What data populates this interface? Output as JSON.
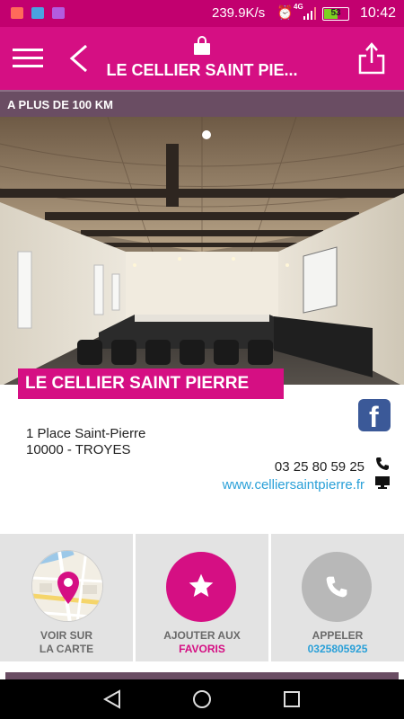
{
  "status_bar": {
    "network_speed": "239.9K/s",
    "network_type": "4G",
    "battery_level": "53",
    "battery_fraction": 0.53,
    "time": "10:42",
    "icons": [
      "notification-heart-icon",
      "notification-cloud-icon",
      "notification-gallery-icon",
      "alarm-icon",
      "signal-icon",
      "battery-icon"
    ]
  },
  "app_bar": {
    "title": "LE CELLIER SAINT PIE...",
    "icons": [
      "menu-icon",
      "back-icon",
      "shopping-bag-icon",
      "share-icon"
    ]
  },
  "distance_label": "A PLUS DE 100 KM",
  "venue": {
    "name": "LE CELLIER SAINT PIERRE",
    "address_line1": "1 Place Saint-Pierre",
    "address_line2": "10000 - TROYES",
    "phone": "03 25 80 59 25",
    "website": "www.celliersaintpierre.fr"
  },
  "actions": {
    "map": {
      "line1": "VOIR SUR",
      "line2": "LA CARTE"
    },
    "favorite": {
      "line1": "AJOUTER AUX",
      "line2": "FAVORIS"
    },
    "call": {
      "line1": "APPELER",
      "line2": "0325805925"
    }
  },
  "colors": {
    "brand_pink": "#d50f83",
    "status_bar": "#c2006f",
    "accent_plum": "#6a4d63",
    "link_blue": "#2aa0d8",
    "facebook_blue": "#3b5998"
  }
}
